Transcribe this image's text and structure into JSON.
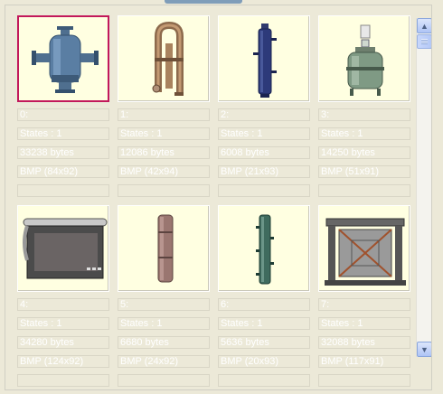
{
  "items": [
    {
      "index": "0:",
      "states": "States : 1",
      "size": "33238 bytes",
      "format": "BMP (84x92)",
      "icon": "separator-vessel-icon",
      "selected": true
    },
    {
      "index": "1:",
      "states": "States : 1",
      "size": "12086 bytes",
      "format": "BMP (42x94)",
      "icon": "u-tube-heat-exchanger-icon",
      "selected": false
    },
    {
      "index": "2:",
      "states": "States : 1",
      "size": "6008 bytes",
      "format": "BMP (21x93)",
      "icon": "column-tower-icon",
      "selected": false
    },
    {
      "index": "3:",
      "states": "States : 1",
      "size": "14250 bytes",
      "format": "BMP (51x91)",
      "icon": "mixing-reactor-icon",
      "selected": false
    },
    {
      "index": "4:",
      "states": "States : 1",
      "size": "34280 bytes",
      "format": "BMP (124x92)",
      "icon": "furnace-box-icon",
      "selected": false
    },
    {
      "index": "5:",
      "states": "States : 1",
      "size": "6680 bytes",
      "format": "BMP (24x92)",
      "icon": "storage-silo-icon",
      "selected": false
    },
    {
      "index": "6:",
      "states": "States : 1",
      "size": "5636 bytes",
      "format": "BMP (20x93)",
      "icon": "packed-column-icon",
      "selected": false
    },
    {
      "index": "7:",
      "states": "States : 1",
      "size": "32088 bytes",
      "format": "BMP (117x91)",
      "icon": "structural-frame-icon",
      "selected": false
    }
  ],
  "colors": {
    "selection": "#c2185b",
    "thumb_bg": "#ffffe1"
  }
}
